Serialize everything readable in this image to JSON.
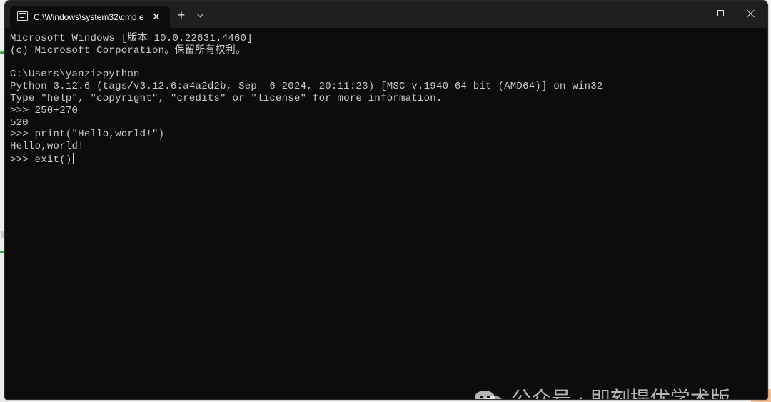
{
  "window": {
    "tab_title": "C:\\Windows\\system32\\cmd.e",
    "tab_close": "✕",
    "new_tab": "+",
    "dropdown_icon": "chevron-down-icon",
    "controls": {
      "minimize_icon": "minimize-icon",
      "maximize_icon": "maximize-icon",
      "close_icon": "close-icon"
    }
  },
  "terminal": {
    "lines": [
      "Microsoft Windows [版本 10.0.22631.4460]",
      "(c) Microsoft Corporation。保留所有权利。",
      "",
      "C:\\Users\\yanzi>python",
      "Python 3.12.6 (tags/v3.12.6:a4a2d2b, Sep  6 2024, 20:11:23) [MSC v.1940 64 bit (AMD64)] on win32",
      "Type \"help\", \"copyright\", \"credits\" or \"license\" for more information.",
      ">>> 250+270",
      "520",
      ">>> print(\"Hello,world!\")",
      "Hello,world!"
    ],
    "current_prompt": ">>> exit()"
  },
  "watermark": {
    "icon": "wechat-icon",
    "text": "公众号 · 即刻提优学术版"
  },
  "colors": {
    "terminal_background": "#0c0c0c",
    "titlebar_background": "#1f1f1f",
    "terminal_text": "#cccccc",
    "accent_green": "#35a853"
  }
}
